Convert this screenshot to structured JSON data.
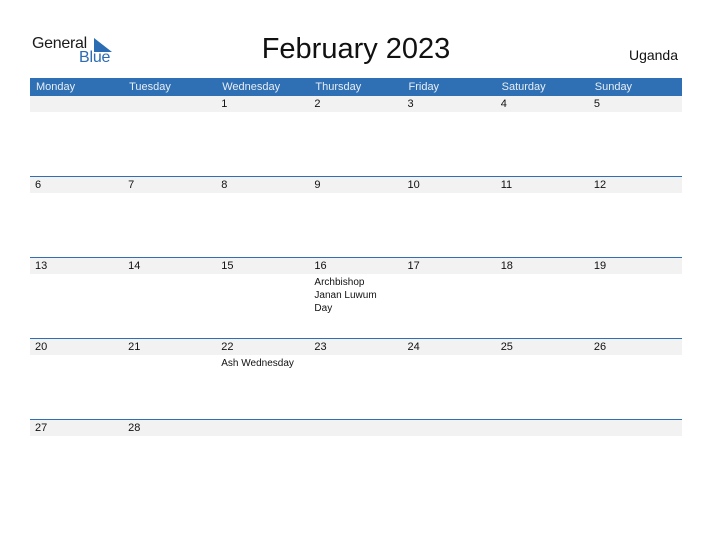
{
  "logo": {
    "general": "General",
    "blue": "Blue",
    "icon": "triangle-flag-icon",
    "brand_color": "#2b6cb3"
  },
  "title": "February 2023",
  "country": "Uganda",
  "header_color": "#2e70b3",
  "weekdays": [
    "Monday",
    "Tuesday",
    "Wednesday",
    "Thursday",
    "Friday",
    "Saturday",
    "Sunday"
  ],
  "weeks": [
    {
      "days": [
        {
          "n": ""
        },
        {
          "n": ""
        },
        {
          "n": "1"
        },
        {
          "n": "2"
        },
        {
          "n": "3"
        },
        {
          "n": "4"
        },
        {
          "n": "5"
        }
      ]
    },
    {
      "days": [
        {
          "n": "6"
        },
        {
          "n": "7"
        },
        {
          "n": "8"
        },
        {
          "n": "9"
        },
        {
          "n": "10"
        },
        {
          "n": "11"
        },
        {
          "n": "12"
        }
      ]
    },
    {
      "days": [
        {
          "n": "13"
        },
        {
          "n": "14"
        },
        {
          "n": "15"
        },
        {
          "n": "16",
          "event": "Archbishop Janan Luwum Day"
        },
        {
          "n": "17"
        },
        {
          "n": "18"
        },
        {
          "n": "19"
        }
      ]
    },
    {
      "days": [
        {
          "n": "20"
        },
        {
          "n": "21"
        },
        {
          "n": "22",
          "event": "Ash Wednesday"
        },
        {
          "n": "23"
        },
        {
          "n": "24"
        },
        {
          "n": "25"
        },
        {
          "n": "26"
        }
      ]
    },
    {
      "days": [
        {
          "n": "27"
        },
        {
          "n": "28"
        },
        {
          "n": ""
        },
        {
          "n": ""
        },
        {
          "n": ""
        },
        {
          "n": ""
        },
        {
          "n": ""
        }
      ]
    }
  ]
}
